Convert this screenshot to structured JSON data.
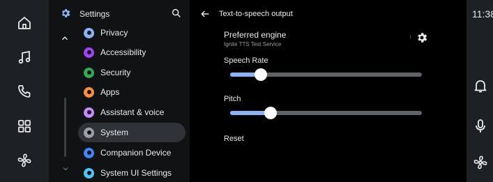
{
  "status_bar": {
    "clock": "11:38"
  },
  "left_rail": {
    "items": [
      {
        "icon": "home-icon"
      },
      {
        "icon": "music-note-icon"
      },
      {
        "icon": "phone-icon"
      },
      {
        "icon": "app-grid-icon"
      },
      {
        "icon": "fan-icon"
      }
    ]
  },
  "right_rail": {
    "items": [
      {
        "icon": "bell-icon"
      },
      {
        "icon": "microphone-icon"
      },
      {
        "icon": "fan-icon"
      }
    ]
  },
  "settings_panel": {
    "title": "Settings",
    "items": [
      {
        "label": "Privacy",
        "color": "#8ab4f8",
        "active": false
      },
      {
        "label": "Accessibility",
        "color": "#a142f4",
        "active": false
      },
      {
        "label": "Security",
        "color": "#34a853",
        "active": false
      },
      {
        "label": "Apps",
        "color": "#fa903e",
        "active": false
      },
      {
        "label": "Assistant & voice",
        "color": "#c58af9",
        "active": false
      },
      {
        "label": "System",
        "color": "#9aa0a6",
        "active": true
      },
      {
        "label": "Companion Device",
        "color": "#4285f4",
        "active": false
      },
      {
        "label": "System UI Settings",
        "color": "#4fc3f7",
        "active": false
      }
    ]
  },
  "main": {
    "title": "Text-to-speech output",
    "preferred_engine": {
      "title": "Preferred engine",
      "subtitle": "Ignite TTS Test Service"
    },
    "speech_rate": {
      "label": "Speech Rate",
      "value": 0.16
    },
    "pitch": {
      "label": "Pitch",
      "value": 0.21
    },
    "reset_label": "Reset"
  },
  "colors": {
    "accent": "#8ab4f8",
    "rail_bg": "#1e2124",
    "panel_bg": "#101214",
    "active_item_bg": "#2f3338"
  }
}
